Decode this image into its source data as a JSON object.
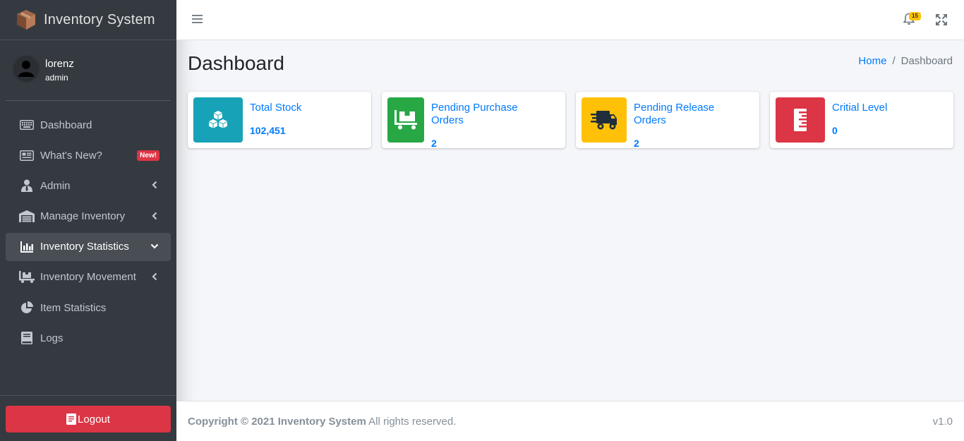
{
  "app": {
    "title": "Inventory System"
  },
  "user": {
    "name": "lorenz",
    "role": "admin"
  },
  "sidebar": {
    "items": [
      {
        "label": "Dashboard",
        "icon": "keyboard-icon"
      },
      {
        "label": "What's New?",
        "icon": "newspaper-icon",
        "badge": "New!"
      },
      {
        "label": "Admin",
        "icon": "user-tie-icon"
      },
      {
        "label": "Manage Inventory",
        "icon": "warehouse-icon"
      },
      {
        "label": "Inventory Statistics",
        "icon": "chart-bar-icon"
      },
      {
        "label": "Inventory Movement",
        "icon": "dolly-icon"
      },
      {
        "label": "Item Statistics",
        "icon": "chart-pie-icon"
      },
      {
        "label": "Logs",
        "icon": "book-icon"
      }
    ],
    "logout_label": "Logout"
  },
  "topbar": {
    "notification_count": "15"
  },
  "page": {
    "title": "Dashboard",
    "breadcrumb": {
      "home": "Home",
      "current": "Dashboard"
    }
  },
  "boxes": [
    {
      "label": "Total Stock",
      "value": "102,451",
      "color": "#17a2b8",
      "icon": "cubes-icon"
    },
    {
      "label": "Pending Purchase Orders",
      "value": "2",
      "color": "#28a745",
      "icon": "dolly-flatbed-icon"
    },
    {
      "label": "Pending Release Orders",
      "value": "2",
      "color": "#ffc107",
      "icon": "shipping-fast-icon"
    },
    {
      "label": "Critial Level",
      "value": "0",
      "color": "#dc3545",
      "icon": "ruler-vertical-icon"
    }
  ],
  "footer": {
    "copyright_prefix": "Copyright © 2021",
    "copyright_brand": "Inventory System",
    "copyright_suffix": "All rights reserved.",
    "version": "v1.0"
  }
}
